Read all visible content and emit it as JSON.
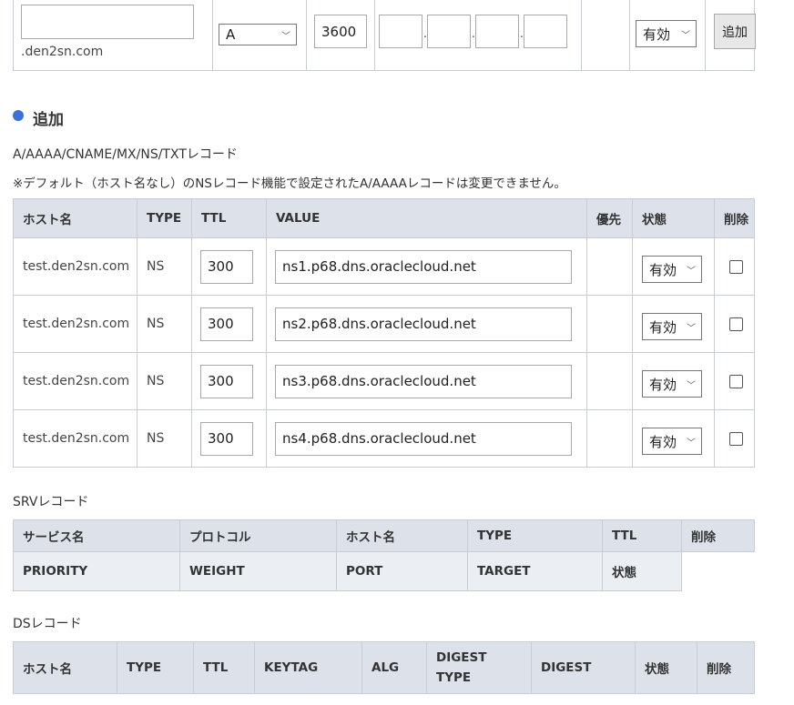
{
  "top_row": {
    "host_value": "",
    "domain_suffix": ".den2sn.com",
    "type_selected": "A",
    "ttl_value": "3600",
    "ip_parts": [
      "",
      "",
      "",
      ""
    ],
    "ip_sep": ".",
    "status_selected": "有効",
    "add_button": "追加"
  },
  "section": {
    "title": "追加"
  },
  "records": {
    "caption": "A/AAAA/CNAME/MX/NS/TXTレコード",
    "note": "※デフォルト（ホスト名なし）のNSレコード機能で設定されたA/AAAAレコードは変更できません。",
    "headers": [
      "ホスト名",
      "TYPE",
      "TTL",
      "VALUE",
      "優先",
      "状態",
      "削除"
    ],
    "rows": [
      {
        "host": "test.den2sn.com",
        "type": "NS",
        "ttl": "300",
        "value": "ns1.p68.dns.oraclecloud.net",
        "status": "有効"
      },
      {
        "host": "test.den2sn.com",
        "type": "NS",
        "ttl": "300",
        "value": "ns2.p68.dns.oraclecloud.net",
        "status": "有効"
      },
      {
        "host": "test.den2sn.com",
        "type": "NS",
        "ttl": "300",
        "value": "ns3.p68.dns.oraclecloud.net",
        "status": "有効"
      },
      {
        "host": "test.den2sn.com",
        "type": "NS",
        "ttl": "300",
        "value": "ns4.p68.dns.oraclecloud.net",
        "status": "有効"
      }
    ]
  },
  "srv": {
    "caption": "SRVレコード",
    "headers1": [
      "サービス名",
      "プロトコル",
      "ホスト名",
      "TYPE",
      "TTL",
      "削除"
    ],
    "headers2": [
      "PRIORITY",
      "WEIGHT",
      "PORT",
      "TARGET",
      "状態"
    ]
  },
  "ds": {
    "caption": "DSレコード",
    "headers": [
      "ホスト名",
      "TYPE",
      "TTL",
      "KEYTAG",
      "ALG",
      "DIGEST TYPE",
      "DIGEST",
      "状態",
      "削除"
    ],
    "digest_type_line1": "DIGEST",
    "digest_type_line2": "TYPE"
  },
  "colors": {
    "accent": "#3a73d8",
    "header_bg": "#dde2ea",
    "border": "#c9cdd3"
  }
}
